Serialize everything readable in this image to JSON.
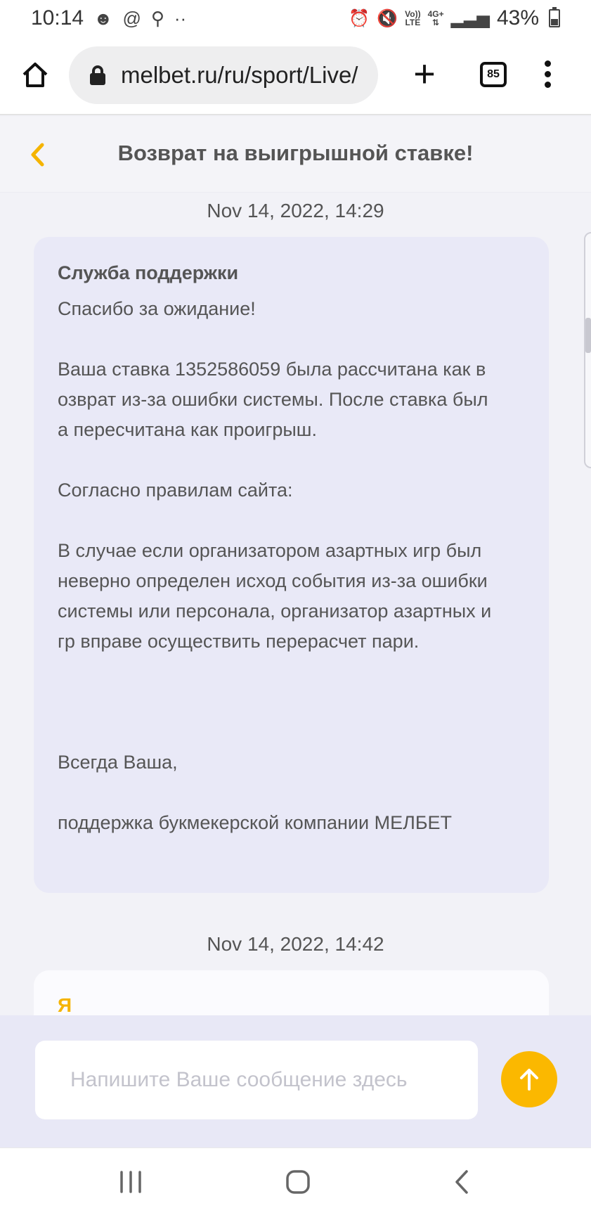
{
  "status_bar": {
    "time": "10:14",
    "left_icons": [
      "face-icon",
      "at-icon",
      "key-icon",
      "dots-icon"
    ],
    "volte_label": "Vo))\nLTE",
    "network_label": "4G+",
    "battery_percent": "43%",
    "battery_level": 0.43
  },
  "browser": {
    "url": "melbet.ru/ru/sport/Live/",
    "tab_count": "85"
  },
  "header": {
    "title": "Возврат на выигрышной ставке!"
  },
  "messages": [
    {
      "timestamp": "Nov 14, 2022, 14:29",
      "sender": "Служба поддержки",
      "lines": [
        "Спасибо за ожидание!",
        "",
        "Ваша ставка 1352586059 была рассчитана как в",
        "озврат из-за ошибки системы. После ставка был",
        "а пересчитана как проигрыш.",
        "",
        "Согласно правилам сайта:",
        "",
        "В случае если организатором азартных игр был",
        "неверно определен исход события из-за ошибки",
        "системы или персонала, организатор азартных и",
        "гр вправе осуществить перерасчет пари.",
        "",
        "",
        "",
        "Всегда Ваша,",
        "",
        "поддержка букмекерской компании МЕЛБЕТ"
      ]
    },
    {
      "timestamp": "Nov 14, 2022, 14:42",
      "sender": "Я"
    }
  ],
  "composer": {
    "placeholder": "Напишите Ваше сообщение здесь",
    "value": ""
  },
  "colors": {
    "accent": "#FBB800",
    "support_bubble": "#E9E9F7",
    "background": "#F2F2F7"
  }
}
